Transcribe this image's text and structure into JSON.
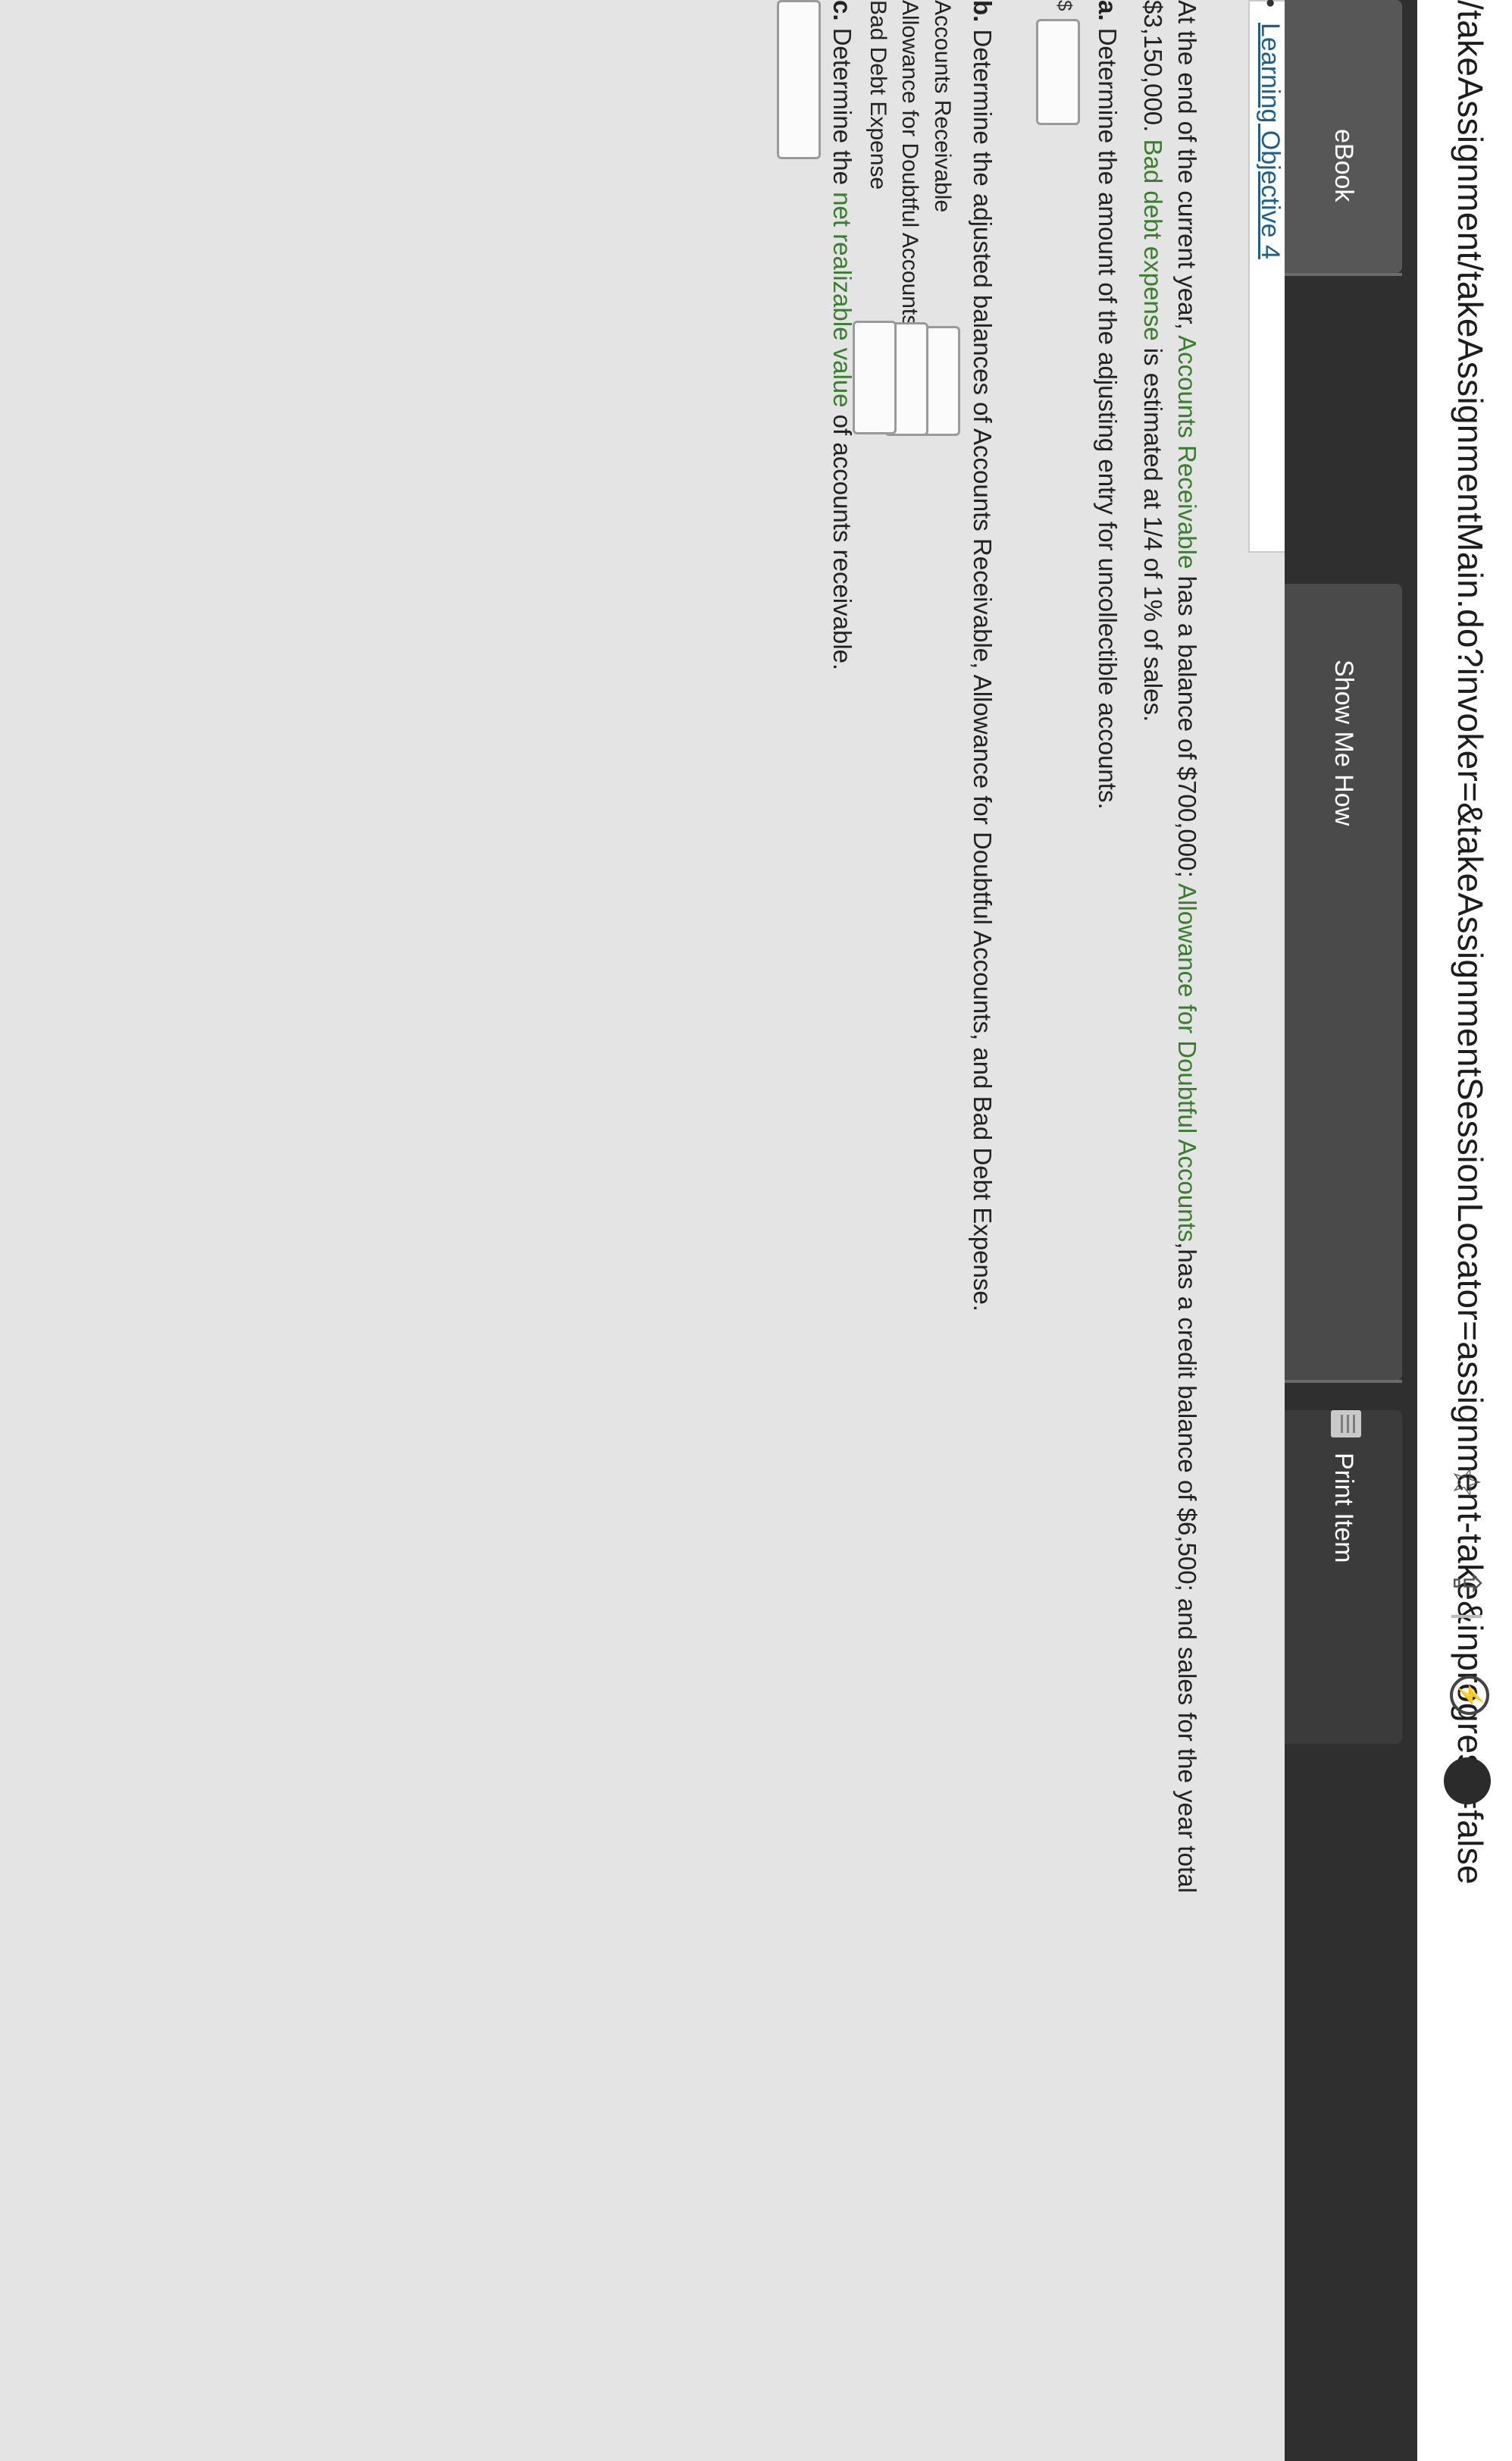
{
  "browser": {
    "url": "/takeAssignment/takeAssignmentMain.do?invoker=&takeAssignmentSessionLocator=assignment-take&inprogress=false"
  },
  "nav": {
    "tabs": [
      {
        "label": "eBook"
      },
      {
        "label": "Show Me How"
      },
      {
        "label": "Print Item"
      }
    ]
  },
  "learning_objective": {
    "label": "Learning Objective 4"
  },
  "problem": {
    "intro_line1_a": "At the end of the current year, ",
    "intro_line1_ar": "Accounts Receivable",
    "intro_line1_b": " has a balance of $700,000; ",
    "intro_line1_allow": "Allowance for Doubtful Accounts",
    "intro_line1_c": ",has a credit balance of $6,500; and sales for the year total",
    "intro_line2_a": "$3,150,000. ",
    "intro_line2_bde": "Bad debt expense",
    "intro_line2_b": " is estimated at 1/4 of 1% of sales.",
    "part_a_letter": "a.",
    "part_a_text": " Determine the amount of the adjusting entry for uncollectible accounts.",
    "part_b_letter": "b.",
    "part_b_text": " Determine the adjusted balances of Accounts Receivable, Allowance for Doubtful Accounts, and Bad Debt Expense.",
    "rows": [
      {
        "label": "Accounts Receivable",
        "currency": "$",
        "value": ""
      },
      {
        "label": "Allowance for Doubtful Accounts",
        "currency": "$",
        "value": ""
      },
      {
        "label": "Bad Debt Expense",
        "currency": "$",
        "value": ""
      }
    ],
    "part_c_letter": "c.",
    "part_c_a": " Determine the ",
    "part_c_nrv": "net realizable value",
    "part_c_b": " of accounts receivable.",
    "currency": "$"
  }
}
